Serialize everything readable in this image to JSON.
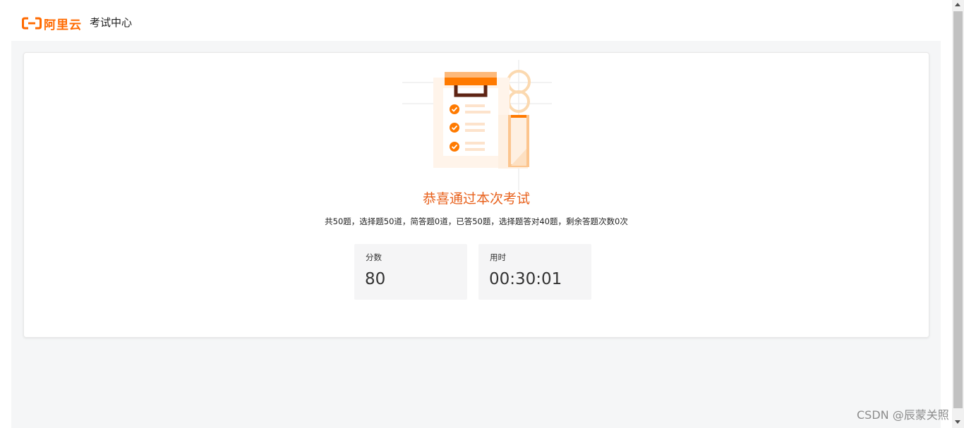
{
  "header": {
    "logo_text": "阿里云",
    "app_title": "考试中心"
  },
  "result": {
    "title": "恭喜通过本次考试",
    "summary": "共50题，选择题50道，简答题0道，已答50题，选择题答对40题，剩余答题次数0次"
  },
  "stats": {
    "score_label": "分数",
    "score_value": "80",
    "time_label": "用时",
    "time_value": "00:30:01"
  },
  "watermark": "CSDN @辰蒙关照",
  "colors": {
    "brand": "#ff6a00",
    "title_orange": "#e8611c",
    "page_bg": "#f5f6f7",
    "stat_bg": "#f5f5f6"
  },
  "icons": {
    "logo": "aliyun-logo-icon",
    "illustration": "exam-clipboard-illustration",
    "check": "check-circle-icon"
  }
}
